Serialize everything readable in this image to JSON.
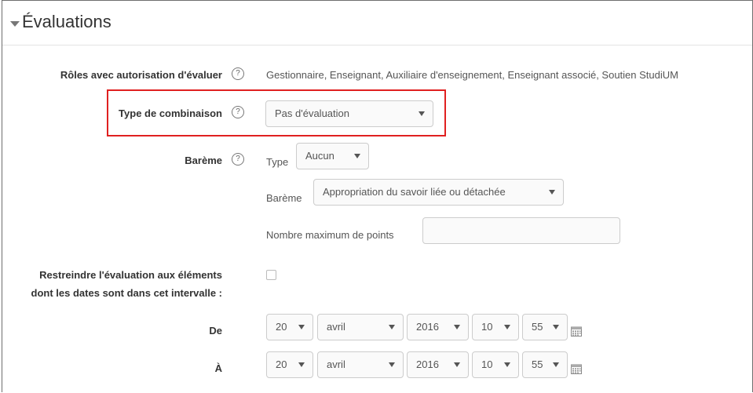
{
  "section": {
    "title": "Évaluations"
  },
  "roles": {
    "label": "Rôles avec autorisation d'évaluer",
    "value": "Gestionnaire, Enseignant, Auxiliaire d'enseignement, Enseignant associé, Soutien StudiUM"
  },
  "combinaison": {
    "label": "Type de combinaison",
    "value": "Pas d'évaluation"
  },
  "bareme": {
    "label": "Barème",
    "type_label": "Type",
    "type_value": "Aucun",
    "scale_label": "Barème",
    "scale_value": "Appropriation du savoir liée ou détachée",
    "maxpoints_label": "Nombre maximum de points",
    "maxpoints_value": ""
  },
  "restrict": {
    "label_line1": "Restreindre l'évaluation aux éléments",
    "label_line2": "dont les dates sont dans cet intervalle :"
  },
  "from": {
    "label": "De",
    "day": "20",
    "month": "avril",
    "year": "2016",
    "hour": "10",
    "minute": "55"
  },
  "to": {
    "label": "À",
    "day": "20",
    "month": "avril",
    "year": "2016",
    "hour": "10",
    "minute": "55"
  },
  "help_glyph": "?",
  "colors": {
    "highlight_border": "#e02020",
    "select_bg": "#fafafa",
    "border": "#cccccc"
  }
}
